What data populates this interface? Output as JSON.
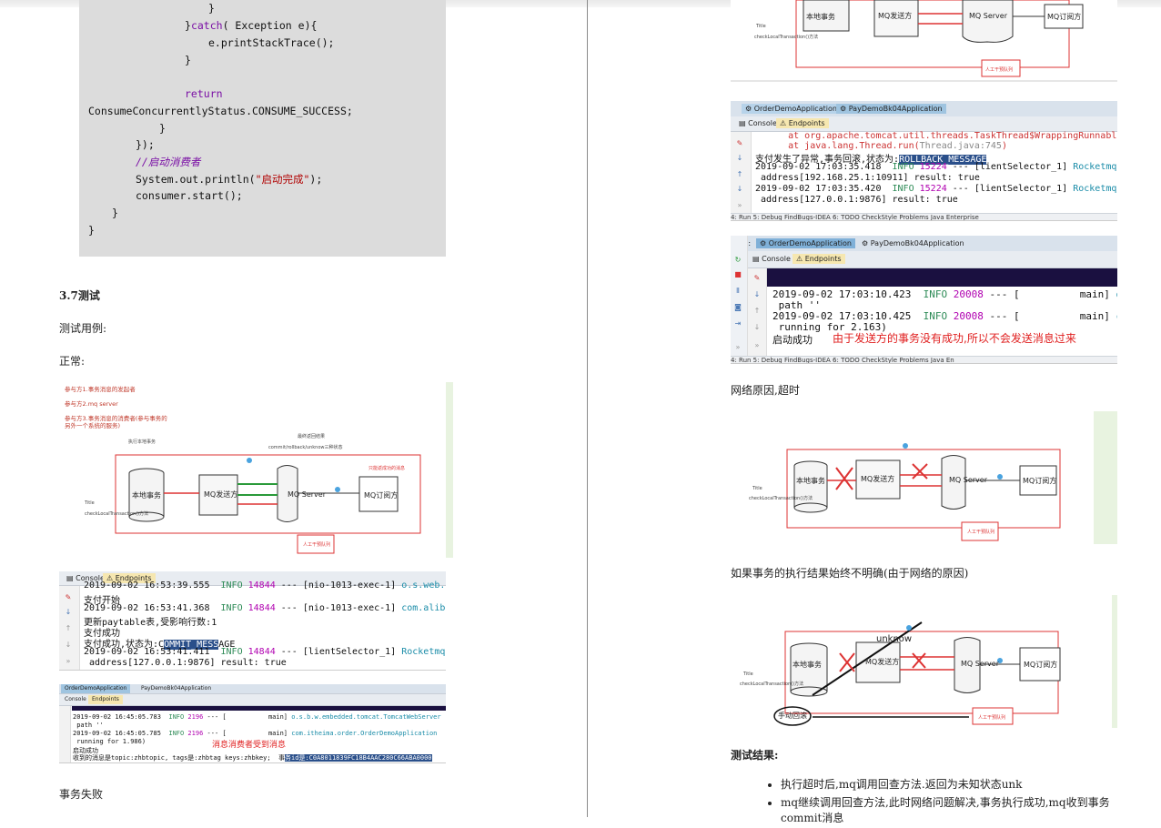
{
  "left_page": {
    "code_lines": [
      {
        "text": "}",
        "indent": 0
      },
      {
        "pre": "}",
        "kw": "catch",
        "post": "( Exception e){"
      },
      {
        "text": "e.printStackTrace();"
      },
      {
        "text": "}"
      },
      {
        "kw_only": "return"
      },
      {
        "text": "ConsumeConcurrentlyStatus.CONSUME_SUCCESS;"
      },
      {
        "text": "}"
      },
      {
        "text": "});"
      },
      {
        "comment": "//启动消费者"
      },
      {
        "pre": "System.out.println(",
        "str": "\"启动完成\"",
        "post": ");"
      },
      {
        "text": "consumer.start();"
      },
      {
        "text": "}"
      },
      {
        "text": "}"
      }
    ],
    "heading_37": "3.7测试",
    "test_case_label": "测试用例:",
    "normal_label": "正常:",
    "diagram1": {
      "notes": [
        "参与方1.事务消息的发起者",
        "参与方2.mq server",
        "参与方3.事务消息的消费者(参与事务的",
        "另外一个系统的服务)"
      ],
      "local_tx": "本地事务",
      "mq_sender": "MQ发送方",
      "mq_server": "MQ Server",
      "mq_subscriber": "MQ订阅方",
      "manual": "人工干预队列",
      "title_small": "Title",
      "check_label": "checkLocalTransaction()方法",
      "exec_label": "执行本地事务",
      "final_label": "最终返回结果",
      "commit_label": "commit/rollback/unknow三种状态",
      "only_label": "只能返成功的消息"
    },
    "console1": {
      "tabs": [
        "Console",
        "Endpoints"
      ],
      "lines": [
        {
          "pre": "2019-09-02 16:53:39.555  ",
          "info": "INFO",
          "pid": " 14844",
          "mid": " --- [nio-1013-exec-1] ",
          "cls": "o.s.web.servlet.Di"
        },
        {
          "plain": "支付开始"
        },
        {
          "pre": "2019-09-02 16:53:41.368  ",
          "info": "INFO",
          "pid": " 14844",
          "mid": " --- [nio-1013-exec-1] ",
          "cls": "com.alibaba.druid."
        },
        {
          "plain": "更新paytable表,受影响行数:1"
        },
        {
          "plain": "支付成功"
        },
        {
          "pre": "支付成功,状态为:C",
          "sel": "OMMIT_MESS",
          "post": "AGE"
        },
        {
          "pre": "2019-09-02 16:53:41.411  ",
          "info": "INFO",
          "pid": " 14844",
          "mid": " --- [lientSelector_1] ",
          "cls": "RocketmqRemoting"
        },
        {
          "plain": " address[127.0.0.1:9876] result: true"
        }
      ]
    },
    "console2": {
      "tabs": [
        "OrderDemoApplication",
        "PayDemoBk04Application"
      ],
      "subtabs": [
        "Console",
        "Endpoints"
      ],
      "lines": [
        {
          "pre": "2019-09-02 16:45:05.783  ",
          "info": "INFO",
          "pid": " 2196",
          "mid": " --- [           main] ",
          "cls": "o.s.b.w.embedded.tomcat.TomcatWebServer"
        },
        {
          "plain": " path ''"
        },
        {
          "pre": "2019-09-02 16:45:05.785  ",
          "info": "INFO",
          "pid": " 2196",
          "mid": " --- [           main] ",
          "cls": "com.itheima.order.OrderDemoApplication"
        },
        {
          "plain": " running for 1.986)"
        },
        {
          "plain": "启动成功"
        },
        {
          "pre": "收到的消息是topic:zhbtopic, tags是:zhbtag keys:zhbkey;  事",
          "hl": "务id是:C0A8011839FC18B4AAC280C66ABA0000"
        }
      ],
      "note": "消息消费者受到消息"
    },
    "tx_fail_label": "事务失败"
  },
  "right_page": {
    "diagram_top": {
      "local_tx": "本地事务",
      "mq_sender": "MQ发送方",
      "mq_server": "MQ Server",
      "mq_subscriber": "MQ订阅方",
      "title_small": "Title",
      "check_label": "checkLocalTransaction()方法",
      "manual": "人工干预队列"
    },
    "console3": {
      "tabs": [
        "OrderDemoApplication",
        "PayDemoBk04Application"
      ],
      "subtabs": [
        "Console",
        "Endpoints"
      ],
      "lines": [
        {
          "plain": "      at org.apache.tomcat.util.threads.TaskThread$WrappingRunnable.run(TaskT"
        },
        {
          "plain": "      at java.lang.Thread.run(",
          "gray": "Thread.java:745",
          "post": ")"
        },
        {
          "pre": "支付发生了异常,事务回滚,状态为:",
          "hl": "ROLLBACK_MESSAGE"
        },
        {
          "pre": "2019-09-02 17:03:35.418  ",
          "info": "INFO",
          "pid": " 15224",
          "mid": " --- [lientSelector_1] ",
          "cls": "RocketmqRemoting"
        },
        {
          "plain": " address[192.168.25.1:10911] result: true"
        },
        {
          "pre": "2019-09-02 17:03:35.420  ",
          "info": "INFO",
          "pid": " 15224",
          "mid": " --- [lientSelector_1] ",
          "cls": "RocketmqRemoting"
        },
        {
          "plain": " address[127.0.0.1:9876] result: true"
        }
      ],
      "status": "4: Run    5: Debug    FindBugs-IDEA    6: TODO    CheckStyle    Problems    Java Enterprise"
    },
    "console4": {
      "run_label": "Run:",
      "tabs": [
        "OrderDemoApplication",
        "PayDemoBk04Application"
      ],
      "subtabs": [
        "Console",
        "Endpoints"
      ],
      "lines": [
        {
          "pre": "2019-09-02 17:03:10.423  ",
          "info": "INFO",
          "pid": " 20008",
          "mid": " --- [          main] ",
          "cls": "o.s.b.w.e"
        },
        {
          "plain": " path ''"
        },
        {
          "pre": "2019-09-02 17:03:10.425  ",
          "info": "INFO",
          "pid": " 20008",
          "mid": " --- [          main] ",
          "cls": "com.ithei"
        },
        {
          "plain": " running for 2.163)"
        },
        {
          "plain": "启动成功"
        }
      ],
      "note": "由于发送方的事务没有成功,所以不会发送消息过来",
      "status": "4: Run    5: Debug    FindBugs-IDEA    6: TODO    CheckStyle    Problems    Java En"
    },
    "network_label": "网络原因,超时",
    "diagram3": {
      "local_tx": "本地事务",
      "mq_sender": "MQ发送方",
      "mq_server": "MQ Server",
      "mq_subscriber": "MQ订阅方",
      "title_small": "Title",
      "check_label": "checkLocalTransaction()方法",
      "manual": "人工干预队列"
    },
    "unclear_label": "如果事务的执行结果始终不明确(由于网络的原因)",
    "diagram4": {
      "local_tx": "本地事务",
      "mq_sender": "MQ发送方",
      "mq_server": "MQ Server",
      "mq_subscriber": "MQ订阅方",
      "unknow": "unknow",
      "manual_rollback": "手动回滚",
      "title_small": "Title",
      "check_label": "checkLocalTransaction()方法",
      "manual": "人工干预队列"
    },
    "results_label": "测试结果:",
    "results": [
      "执行超时后,mq调用回查方法.返回为未知状态unk",
      "mq继续调用回查方法,此时网络问题解决,事务执行成功,mq收到事务",
      "commit消息"
    ]
  }
}
